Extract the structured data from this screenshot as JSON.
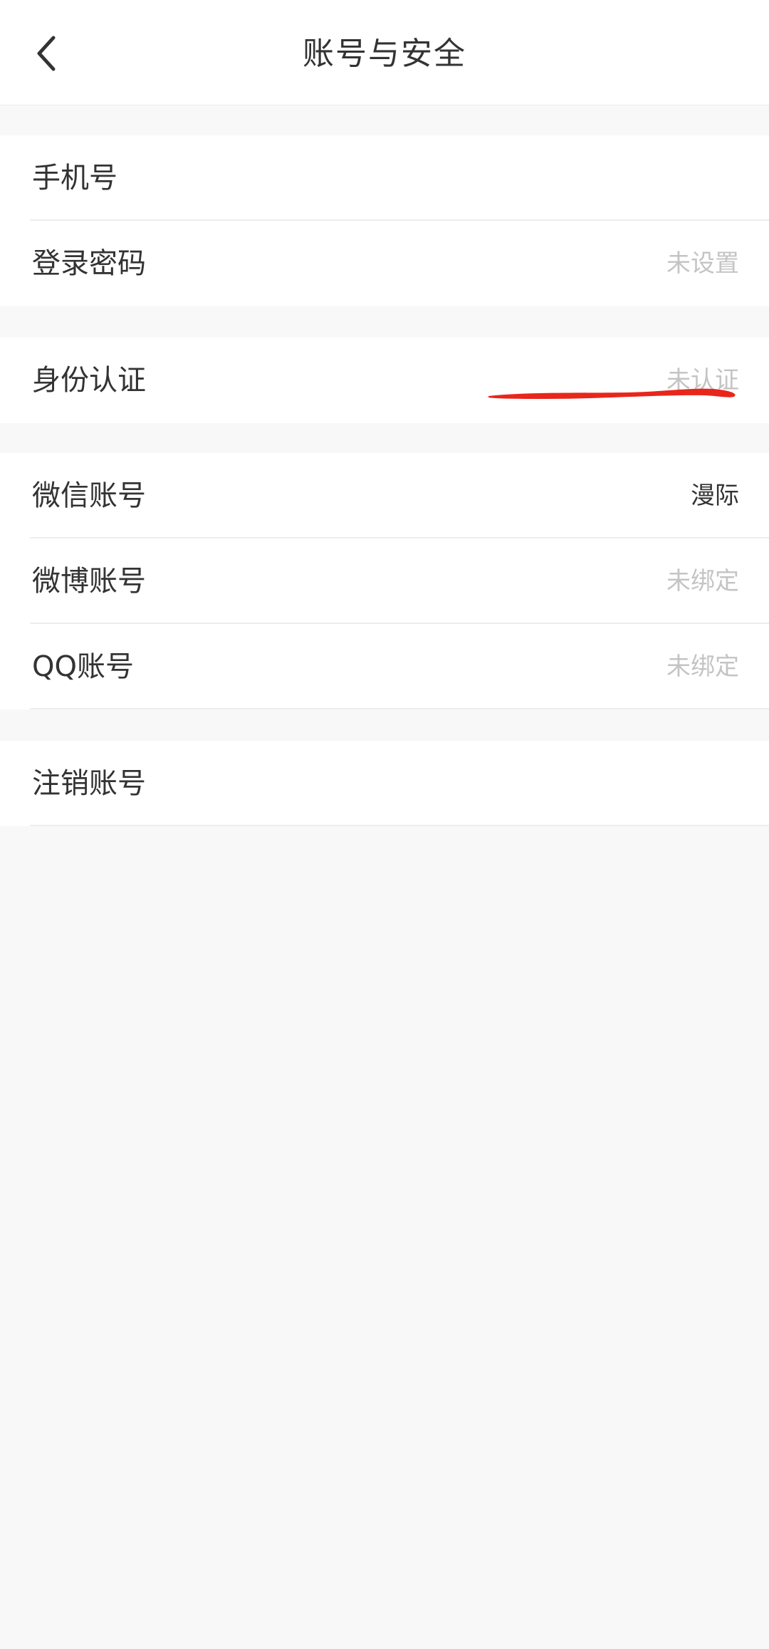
{
  "header": {
    "title": "账号与安全",
    "back_icon": "chevron-left-icon"
  },
  "groups": {
    "account": {
      "phone": {
        "label": "手机号",
        "value": ""
      },
      "password": {
        "label": "登录密码",
        "value": "未设置"
      }
    },
    "identity": {
      "verify": {
        "label": "身份认证",
        "value": "未认证"
      }
    },
    "bindings": {
      "wechat": {
        "label": "微信账号",
        "value": "漫际"
      },
      "weibo": {
        "label": "微博账号",
        "value": "未绑定"
      },
      "qq": {
        "label": "QQ账号",
        "value": "未绑定"
      }
    },
    "danger": {
      "cancel": {
        "label": "注销账号"
      }
    }
  },
  "colors": {
    "background": "#f8f8f8",
    "card": "#ffffff",
    "text": "#333333",
    "muted": "#c4c4c4",
    "scribble": "#e8261b"
  }
}
